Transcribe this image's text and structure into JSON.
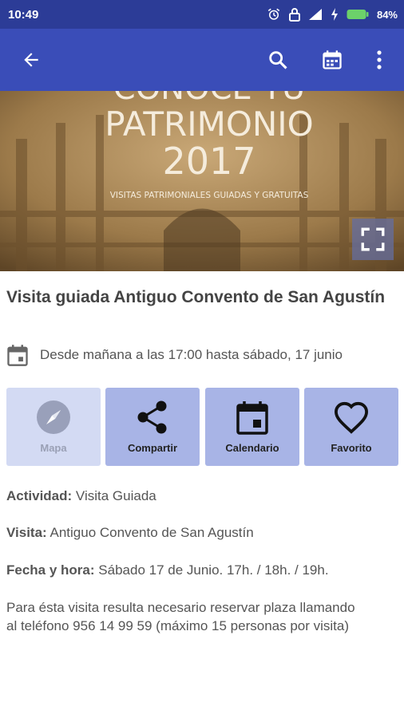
{
  "status": {
    "time": "10:49",
    "battery": "84%"
  },
  "appbar": {
    "icons": [
      "arrow-back-icon",
      "search-icon",
      "calendar-icon",
      "more-vert-icon"
    ]
  },
  "hero": {
    "line1": "CONOCE TU",
    "line2": "PATRIMONIO",
    "line3": "2017",
    "line4": "VISITAS PATRIMONIALES GUIADAS Y GRATUITAS"
  },
  "event": {
    "title": "Visita guiada Antiguo Convento de San Agustín",
    "date": "Desde mañana a las 17:00 hasta sábado, 17 junio"
  },
  "actions": [
    {
      "label": "Mapa",
      "icon": "compass-icon",
      "enabled": false
    },
    {
      "label": "Compartir",
      "icon": "share-icon",
      "enabled": true
    },
    {
      "label": "Calendario",
      "icon": "calendar-icon",
      "enabled": true
    },
    {
      "label": "Favorito",
      "icon": "heart-outline-icon",
      "enabled": true
    }
  ],
  "details": {
    "activity_label": "Actividad:",
    "activity_value": "Visita Guiada",
    "visit_label": "Visita:",
    "visit_value": "Antiguo Convento de San Agustín",
    "datetime_label": "Fecha y hora:",
    "datetime_value": "Sábado 17 de Junio. 17h. / 18h. / 19h.",
    "note": "Para ésta visita resulta necesario reservar plaza llamando al teléfono 956 14 99 59 (máximo 15 personas por visita)"
  },
  "colors": {
    "statusbar": "#2c3c97",
    "appbar": "#3a4db8",
    "action_bg": "#a8b4e6",
    "action_disabled_bg": "#d3daf3"
  }
}
